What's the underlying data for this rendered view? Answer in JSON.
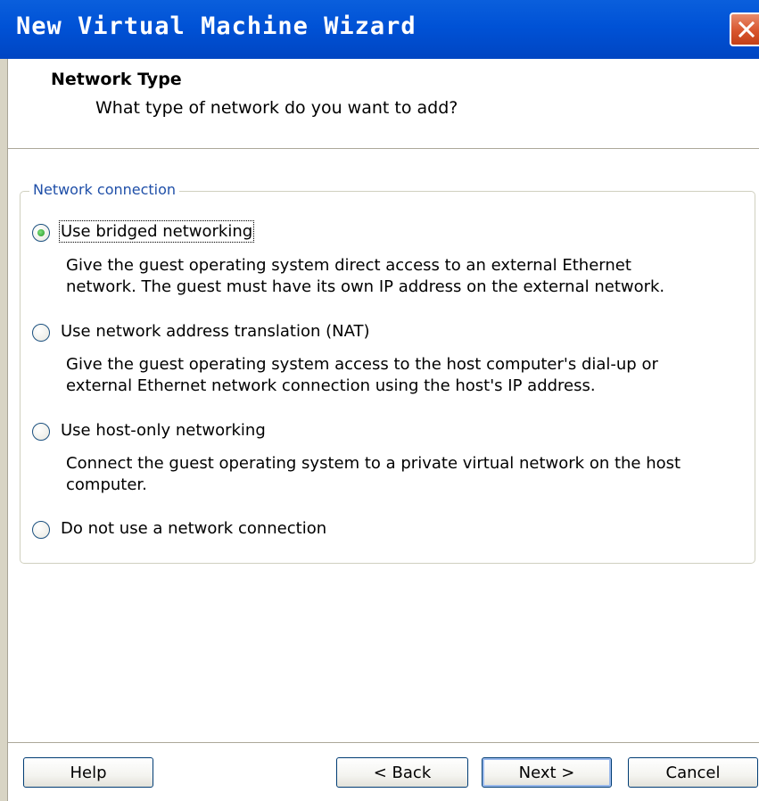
{
  "window": {
    "title": "New Virtual Machine Wizard"
  },
  "header": {
    "title": "Network Type",
    "subtitle": "What type of network do you want to add?"
  },
  "group": {
    "label": "Network connection"
  },
  "options": [
    {
      "label": "Use bridged networking",
      "selected": true,
      "description_lines": [
        "Give the guest operating system direct access to an external Ethernet",
        "network. The guest must have its own IP address on the external network."
      ]
    },
    {
      "label": "Use network address translation (NAT)",
      "selected": false,
      "description_lines": [
        "Give the guest operating system access to the host computer's dial-up or",
        "external Ethernet network connection using the host's IP address."
      ]
    },
    {
      "label": "Use host-only networking",
      "selected": false,
      "description_lines": [
        "Connect the guest operating system to a private virtual network on the host",
        "computer."
      ]
    },
    {
      "label": "Do not use a network connection",
      "selected": false,
      "description_lines": []
    }
  ],
  "buttons": {
    "help": "Help",
    "back": "< Back",
    "next": "Next >",
    "cancel": "Cancel"
  },
  "colors": {
    "titlebar": "#0052d6",
    "group_label": "#1f4fa8",
    "close_button": "#d8552d"
  },
  "icons": {
    "close": "close-icon"
  }
}
